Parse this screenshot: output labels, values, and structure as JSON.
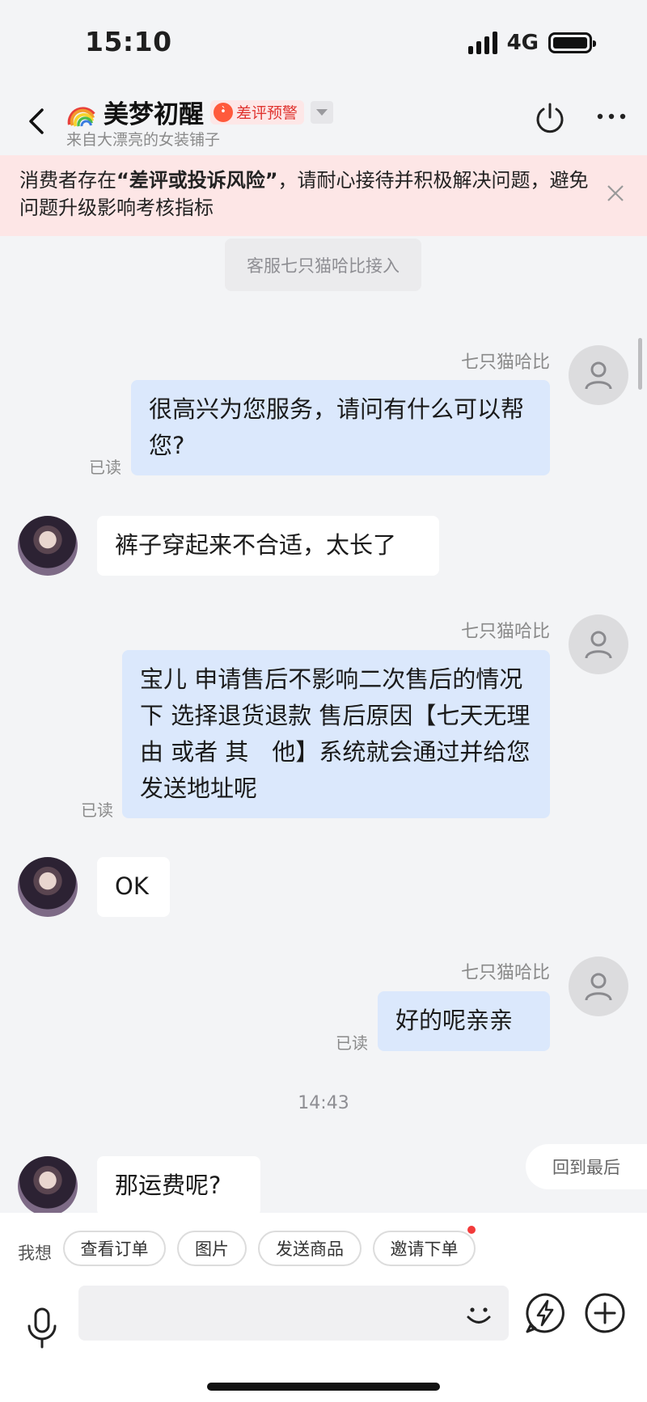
{
  "status_bar": {
    "time": "15:10",
    "network": "4G"
  },
  "header": {
    "title": "美梦初醒",
    "badge": "差评预警",
    "subtitle": "来自大漂亮的女装铺子"
  },
  "warning_banner": {
    "text_before": "消费者存在",
    "text_bold": "“差评或投诉风险”",
    "text_after": "，请耐心接待并积极解决问题，避免问题升级影响考核指标"
  },
  "system_notice": "客服七只猫哈比接入",
  "messages": [
    {
      "sender": "七只猫哈比",
      "text": "很高兴为您服务，请问有什么可以帮您?",
      "read": "已读"
    },
    {
      "text": "裤子穿起来不合适，太长了"
    },
    {
      "sender": "七只猫哈比",
      "text": "宝儿 申请售后不影响二次售后的情况下 选择退货退款 售后原因【七天无理由 或者 其　他】系统就会通过并给您发送地址呢",
      "read": "已读"
    },
    {
      "text": "OK"
    },
    {
      "sender": "七只猫哈比",
      "text": "好的呢亲亲",
      "read": "已读"
    },
    {
      "text": "那运费呢?"
    }
  ],
  "time_separator": "14:43",
  "back_to_last": "回到最后",
  "quick_actions": {
    "label": "我想",
    "chips": [
      "查看订单",
      "图片",
      "发送商品",
      "邀请下单"
    ]
  },
  "input": {
    "placeholder": ""
  }
}
